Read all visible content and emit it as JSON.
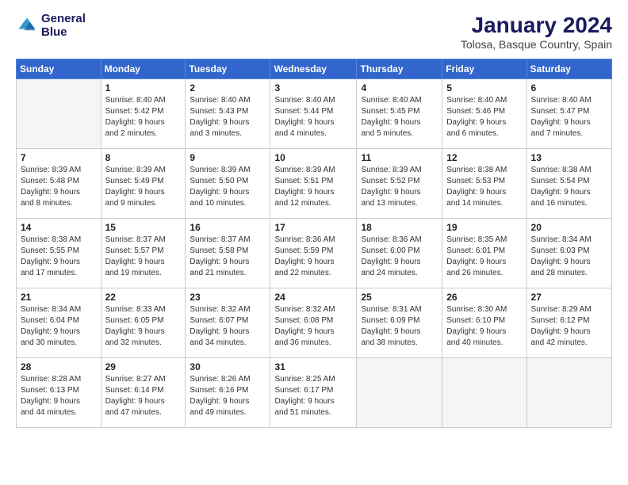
{
  "logo": {
    "line1": "General",
    "line2": "Blue"
  },
  "title": "January 2024",
  "subtitle": "Tolosa, Basque Country, Spain",
  "days_header": [
    "Sunday",
    "Monday",
    "Tuesday",
    "Wednesday",
    "Thursday",
    "Friday",
    "Saturday"
  ],
  "weeks": [
    [
      {
        "day": "",
        "info": ""
      },
      {
        "day": "1",
        "info": "Sunrise: 8:40 AM\nSunset: 5:42 PM\nDaylight: 9 hours\nand 2 minutes."
      },
      {
        "day": "2",
        "info": "Sunrise: 8:40 AM\nSunset: 5:43 PM\nDaylight: 9 hours\nand 3 minutes."
      },
      {
        "day": "3",
        "info": "Sunrise: 8:40 AM\nSunset: 5:44 PM\nDaylight: 9 hours\nand 4 minutes."
      },
      {
        "day": "4",
        "info": "Sunrise: 8:40 AM\nSunset: 5:45 PM\nDaylight: 9 hours\nand 5 minutes."
      },
      {
        "day": "5",
        "info": "Sunrise: 8:40 AM\nSunset: 5:46 PM\nDaylight: 9 hours\nand 6 minutes."
      },
      {
        "day": "6",
        "info": "Sunrise: 8:40 AM\nSunset: 5:47 PM\nDaylight: 9 hours\nand 7 minutes."
      }
    ],
    [
      {
        "day": "7",
        "info": "Sunrise: 8:39 AM\nSunset: 5:48 PM\nDaylight: 9 hours\nand 8 minutes."
      },
      {
        "day": "8",
        "info": "Sunrise: 8:39 AM\nSunset: 5:49 PM\nDaylight: 9 hours\nand 9 minutes."
      },
      {
        "day": "9",
        "info": "Sunrise: 8:39 AM\nSunset: 5:50 PM\nDaylight: 9 hours\nand 10 minutes."
      },
      {
        "day": "10",
        "info": "Sunrise: 8:39 AM\nSunset: 5:51 PM\nDaylight: 9 hours\nand 12 minutes."
      },
      {
        "day": "11",
        "info": "Sunrise: 8:39 AM\nSunset: 5:52 PM\nDaylight: 9 hours\nand 13 minutes."
      },
      {
        "day": "12",
        "info": "Sunrise: 8:38 AM\nSunset: 5:53 PM\nDaylight: 9 hours\nand 14 minutes."
      },
      {
        "day": "13",
        "info": "Sunrise: 8:38 AM\nSunset: 5:54 PM\nDaylight: 9 hours\nand 16 minutes."
      }
    ],
    [
      {
        "day": "14",
        "info": "Sunrise: 8:38 AM\nSunset: 5:55 PM\nDaylight: 9 hours\nand 17 minutes."
      },
      {
        "day": "15",
        "info": "Sunrise: 8:37 AM\nSunset: 5:57 PM\nDaylight: 9 hours\nand 19 minutes."
      },
      {
        "day": "16",
        "info": "Sunrise: 8:37 AM\nSunset: 5:58 PM\nDaylight: 9 hours\nand 21 minutes."
      },
      {
        "day": "17",
        "info": "Sunrise: 8:36 AM\nSunset: 5:59 PM\nDaylight: 9 hours\nand 22 minutes."
      },
      {
        "day": "18",
        "info": "Sunrise: 8:36 AM\nSunset: 6:00 PM\nDaylight: 9 hours\nand 24 minutes."
      },
      {
        "day": "19",
        "info": "Sunrise: 8:35 AM\nSunset: 6:01 PM\nDaylight: 9 hours\nand 26 minutes."
      },
      {
        "day": "20",
        "info": "Sunrise: 8:34 AM\nSunset: 6:03 PM\nDaylight: 9 hours\nand 28 minutes."
      }
    ],
    [
      {
        "day": "21",
        "info": "Sunrise: 8:34 AM\nSunset: 6:04 PM\nDaylight: 9 hours\nand 30 minutes."
      },
      {
        "day": "22",
        "info": "Sunrise: 8:33 AM\nSunset: 6:05 PM\nDaylight: 9 hours\nand 32 minutes."
      },
      {
        "day": "23",
        "info": "Sunrise: 8:32 AM\nSunset: 6:07 PM\nDaylight: 9 hours\nand 34 minutes."
      },
      {
        "day": "24",
        "info": "Sunrise: 8:32 AM\nSunset: 6:08 PM\nDaylight: 9 hours\nand 36 minutes."
      },
      {
        "day": "25",
        "info": "Sunrise: 8:31 AM\nSunset: 6:09 PM\nDaylight: 9 hours\nand 38 minutes."
      },
      {
        "day": "26",
        "info": "Sunrise: 8:30 AM\nSunset: 6:10 PM\nDaylight: 9 hours\nand 40 minutes."
      },
      {
        "day": "27",
        "info": "Sunrise: 8:29 AM\nSunset: 6:12 PM\nDaylight: 9 hours\nand 42 minutes."
      }
    ],
    [
      {
        "day": "28",
        "info": "Sunrise: 8:28 AM\nSunset: 6:13 PM\nDaylight: 9 hours\nand 44 minutes."
      },
      {
        "day": "29",
        "info": "Sunrise: 8:27 AM\nSunset: 6:14 PM\nDaylight: 9 hours\nand 47 minutes."
      },
      {
        "day": "30",
        "info": "Sunrise: 8:26 AM\nSunset: 6:16 PM\nDaylight: 9 hours\nand 49 minutes."
      },
      {
        "day": "31",
        "info": "Sunrise: 8:25 AM\nSunset: 6:17 PM\nDaylight: 9 hours\nand 51 minutes."
      },
      {
        "day": "",
        "info": ""
      },
      {
        "day": "",
        "info": ""
      },
      {
        "day": "",
        "info": ""
      }
    ]
  ]
}
